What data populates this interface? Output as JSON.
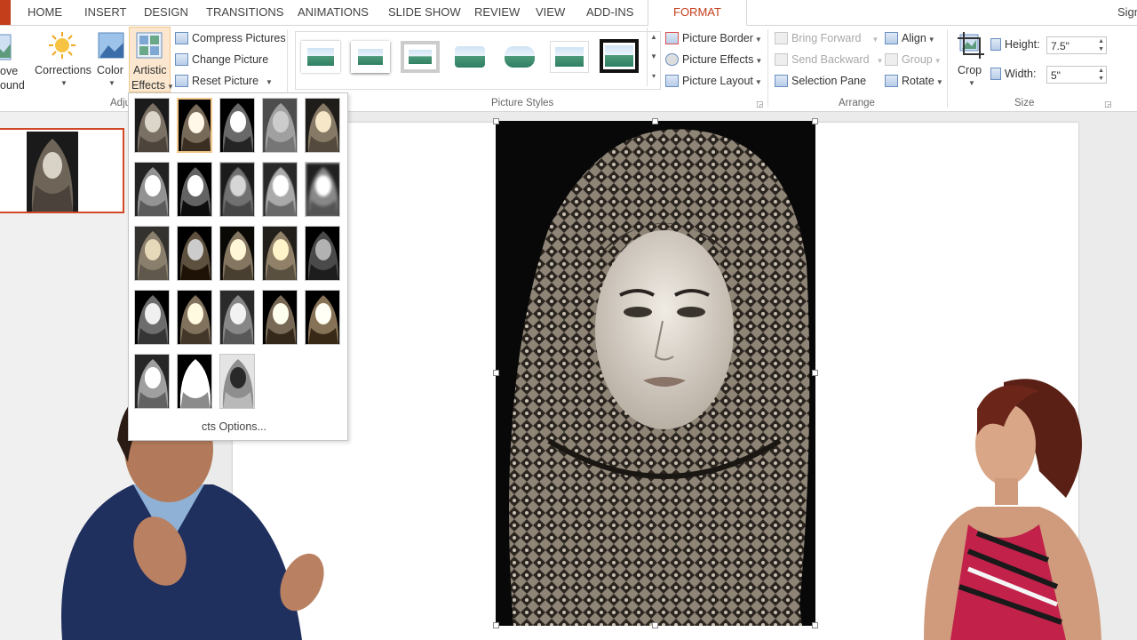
{
  "tabs": [
    "HOME",
    "INSERT",
    "DESIGN",
    "TRANSITIONS",
    "ANIMATIONS",
    "SLIDE SHOW",
    "REVIEW",
    "VIEW",
    "ADD-INS"
  ],
  "active_tab": "FORMAT",
  "signin": "Sign",
  "adjust": {
    "remove_bg_line1": "ove",
    "remove_bg_line2": "ound",
    "corrections": "Corrections",
    "color": "Color",
    "artistic_line1": "Artistic",
    "artistic_line2": "Effects",
    "compress": "Compress Pictures",
    "change": "Change Picture",
    "reset": "Reset Picture",
    "group_label": "Adju"
  },
  "picture_styles": {
    "border": "Picture Border",
    "effects": "Picture Effects",
    "layout": "Picture Layout",
    "group_label": "Picture Styles"
  },
  "arrange": {
    "bring_forward": "Bring Forward",
    "send_backward": "Send Backward",
    "selection_pane": "Selection Pane",
    "align": "Align",
    "group": "Group",
    "rotate": "Rotate",
    "group_label": "Arrange"
  },
  "size": {
    "crop": "Crop",
    "height_label": "Height:",
    "height_value": "7.5\"",
    "width_label": "Width:",
    "width_value": "5\"",
    "group_label": "Size"
  },
  "effects_menu": {
    "options_link": "cts Options..."
  },
  "colors": {
    "accent": "#c43e1c",
    "thumb_border": "#d24726",
    "gallery_hover": "#f2c98a"
  }
}
